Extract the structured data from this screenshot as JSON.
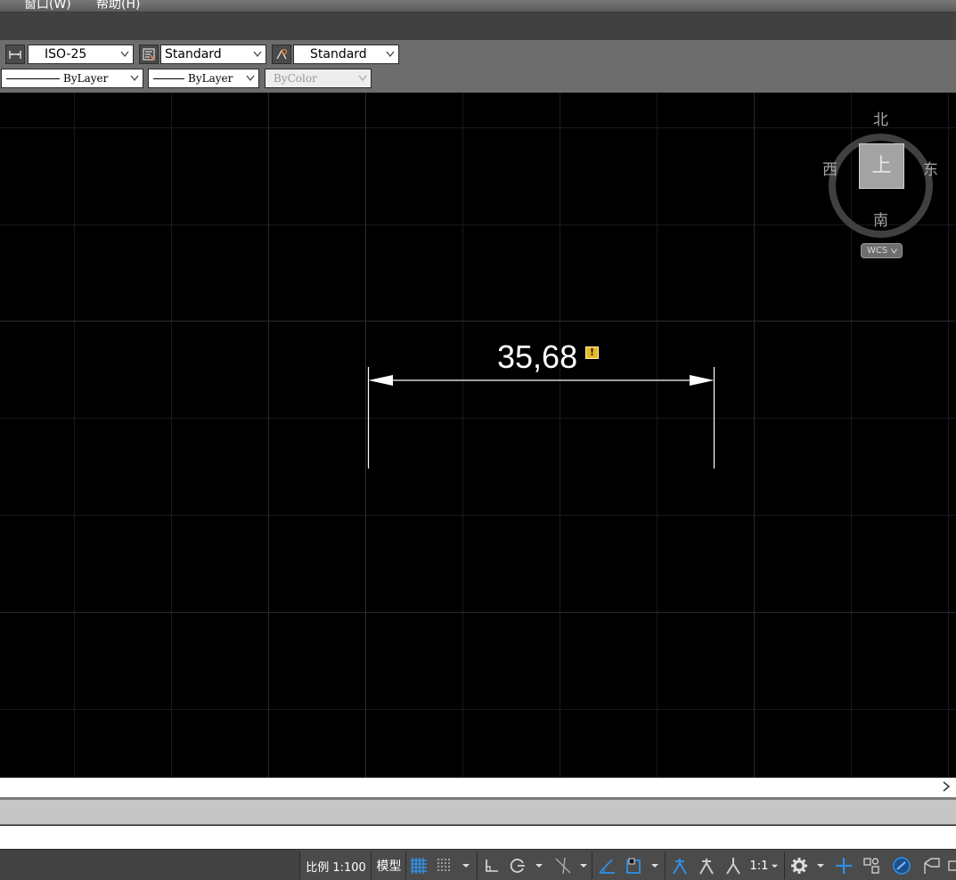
{
  "menu": {
    "items": [
      "窗口(W)",
      "帮助(H)"
    ]
  },
  "toolbar": {
    "dim_style": "ISO-25",
    "text_style": "Standard",
    "table_style": "Standard",
    "linetype_a": "ByLayer",
    "linetype_b": "ByLayer",
    "plot_color": "ByColor"
  },
  "viewcube": {
    "north": "北",
    "south": "南",
    "east": "东",
    "west": "西",
    "face": "上",
    "wcs": "WCS"
  },
  "drawing": {
    "dimension_value": "35,68",
    "warning_glyph": "!"
  },
  "statusbar": {
    "scale": "比例 1:100",
    "model": "模型",
    "annotation_scale": "1:1"
  },
  "colors": {
    "canvas_bg": "#000000",
    "grid_line": "#1c1f24",
    "grid_major": "#2a2f36",
    "accent_blue": "#2f8fe6",
    "warning_yellow": "#e8b829"
  },
  "icons": [
    "dim-style-icon",
    "text-style-icon",
    "table-style-icon",
    "grid-icon",
    "snap-icon",
    "ortho-icon",
    "polar-icon",
    "osnap-icon",
    "otrack-icon",
    "isodraft-icon",
    "annotation-icon",
    "gear-icon",
    "plus-icon",
    "workspace-icon",
    "chevron-right-icon"
  ]
}
